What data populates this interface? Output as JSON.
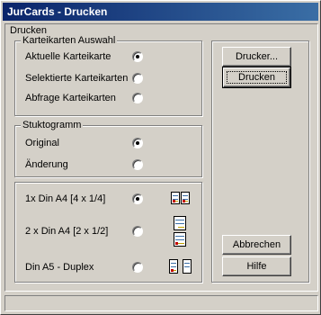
{
  "window": {
    "title": "JurCards - Drucken"
  },
  "dialog": {
    "frame_label": "Drucken",
    "karteikarten_auswahl": {
      "label": "Karteikarten Auswahl",
      "options": [
        {
          "label": "Aktuelle Karteikarte",
          "checked": true
        },
        {
          "label": "Selektierte Karteikarten",
          "checked": false
        },
        {
          "label": "Abfrage Karteikarten",
          "checked": false
        }
      ]
    },
    "stuktogramm": {
      "label": "Stuktogramm",
      "options": [
        {
          "label": "Original",
          "checked": true
        },
        {
          "label": "Änderung",
          "checked": false
        }
      ]
    },
    "layout": {
      "options": [
        {
          "label": "1x Din A4 [4 x 1/4]",
          "checked": true,
          "icon": "layout-1xa4-icon"
        },
        {
          "label": "2 x Din A4 [2 x 1/2]",
          "checked": false,
          "icon": "layout-2xa4-icon"
        },
        {
          "label": "Din A5 - Duplex",
          "checked": false,
          "icon": "layout-a5-duplex-icon"
        }
      ]
    },
    "buttons": {
      "drucker": "Drucker...",
      "drucken": "Drucken",
      "abbrechen": "Abbrechen",
      "hilfe": "Hilfe"
    }
  },
  "status": {
    "text": ""
  },
  "colors": {
    "titlebar_start": "#0a246a",
    "titlebar_end": "#3a6ea5",
    "face": "#d4d0c8"
  }
}
